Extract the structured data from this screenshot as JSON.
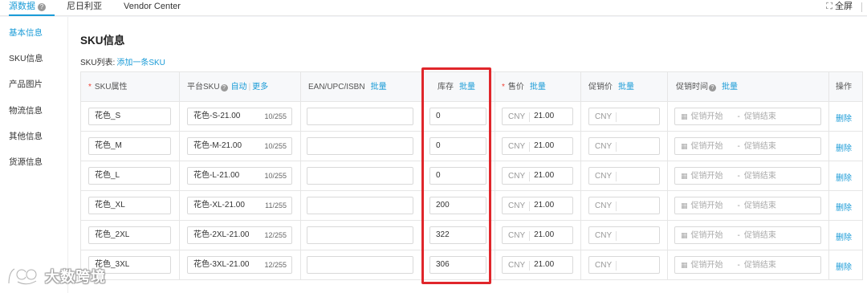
{
  "top_tabs": [
    {
      "label": "源数据",
      "active": true
    },
    {
      "label": "尼日利亚"
    },
    {
      "label": "Vendor Center"
    }
  ],
  "top_right": {
    "fullscreen_label": "全屏"
  },
  "sidebar": {
    "items": [
      {
        "label": "基本信息",
        "active": true
      },
      {
        "label": "SKU信息"
      },
      {
        "label": "产品图片"
      },
      {
        "label": "物流信息"
      },
      {
        "label": "其他信息"
      },
      {
        "label": "货源信息"
      }
    ]
  },
  "section": {
    "title": "SKU信息",
    "sku_list_label": "SKU列表:",
    "add_sku_link": "添加一条SKU"
  },
  "table": {
    "headers": {
      "attr": "SKU属性",
      "platform_sku": "平台SKU",
      "auto": "自动",
      "more": "更多",
      "ean": "EAN/UPC/ISBN",
      "stock": "库存",
      "price": "售价",
      "promo_price": "促销价",
      "promo_time": "促销时间",
      "action": "操作",
      "batch": "批量",
      "sep": "|"
    },
    "currency": "CNY",
    "date_start_placeholder": "促销开始",
    "date_end_placeholder": "促销结束",
    "date_dash": "-",
    "delete_label": "删除",
    "rows": [
      {
        "attr": "花色_S",
        "sku": "花色-S-21.00",
        "count": "10/255",
        "stock": "0",
        "price": "21.00"
      },
      {
        "attr": "花色_M",
        "sku": "花色-M-21.00",
        "count": "10/255",
        "stock": "0",
        "price": "21.00"
      },
      {
        "attr": "花色_L",
        "sku": "花色-L-21.00",
        "count": "10/255",
        "stock": "0",
        "price": "21.00"
      },
      {
        "attr": "花色_XL",
        "sku": "花色-XL-21.00",
        "count": "11/255",
        "stock": "200",
        "price": "21.00"
      },
      {
        "attr": "花色_2XL",
        "sku": "花色-2XL-21.00",
        "count": "12/255",
        "stock": "322",
        "price": "21.00"
      },
      {
        "attr": "花色_3XL",
        "sku": "花色-3XL-21.00",
        "count": "12/255",
        "stock": "306",
        "price": "21.00"
      }
    ]
  },
  "watermark": {
    "text": "大数跨境"
  },
  "colors": {
    "accent": "#1a9bd7",
    "required": "#f04134",
    "highlight": "#e0262b"
  }
}
